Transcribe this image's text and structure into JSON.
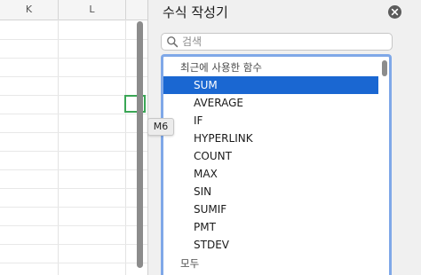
{
  "sheet": {
    "columns": [
      "K",
      "L"
    ],
    "active_cell_tooltip": "M6"
  },
  "panel": {
    "title": "수식 작성기",
    "search": {
      "placeholder": "검색",
      "value": ""
    },
    "list": {
      "recent_header": "최근에 사용한 함수",
      "functions": [
        "SUM",
        "AVERAGE",
        "IF",
        "HYPERLINK",
        "COUNT",
        "MAX",
        "SIN",
        "SUMIF",
        "PMT",
        "STDEV"
      ],
      "selected": "SUM",
      "all_header": "모두"
    }
  },
  "colors": {
    "selection": "#1a67d2",
    "list_focus_ring": "#7fa8e8",
    "active_cell_border": "#3aa655"
  },
  "icons": [
    "close-icon",
    "search-icon"
  ]
}
